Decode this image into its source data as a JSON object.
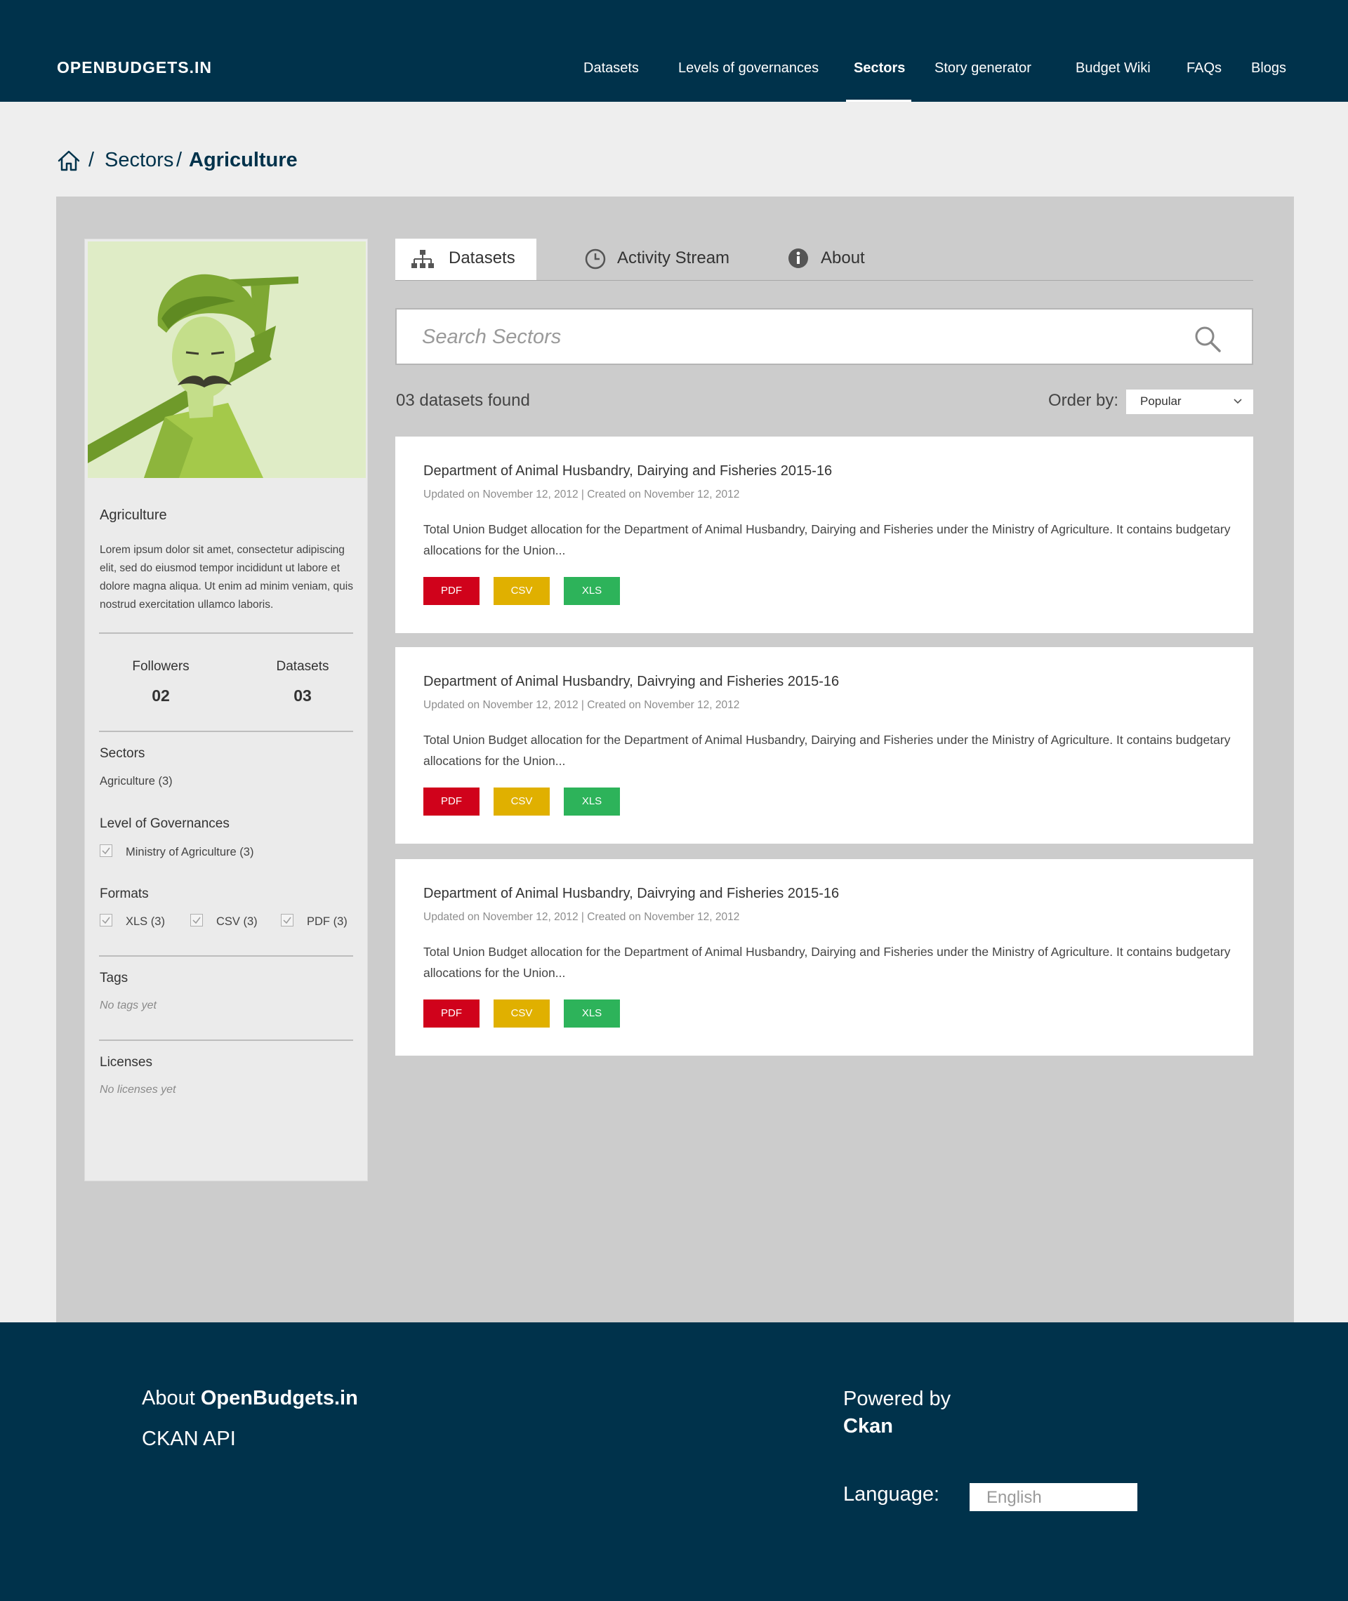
{
  "header": {
    "logo": "OPENBUDGETS.IN",
    "nav": [
      {
        "label": "Datasets",
        "active": false
      },
      {
        "label": "Levels of governances",
        "active": false
      },
      {
        "label": "Sectors",
        "active": true
      },
      {
        "label": "Story generator",
        "active": false
      },
      {
        "label": "Budget Wiki",
        "active": false
      },
      {
        "label": "FAQs",
        "active": false
      },
      {
        "label": "Blogs",
        "active": false
      }
    ]
  },
  "breadcrumb": {
    "sep": "/",
    "parent": "Sectors",
    "current": "Agriculture"
  },
  "sidebar": {
    "title": "Agriculture",
    "description": "Lorem ipsum dolor sit amet, consectetur adipiscing elit, sed do eiusmod tempor incididunt ut labore et dolore magna aliqua. Ut enim ad minim veniam, quis nostrud exercitation ullamco laboris.",
    "followers_label": "Followers",
    "followers_value": "02",
    "datasets_label": "Datasets",
    "datasets_value": "03",
    "sectors_heading": "Sectors",
    "sectors_item": "Agriculture (3)",
    "governance_heading": "Level of Governances",
    "governance_item": "Ministry of Agriculture (3)",
    "formats_heading": "Formats",
    "formats": [
      "XLS (3)",
      "CSV (3)",
      "PDF (3)"
    ],
    "tags_heading": "Tags",
    "tags_empty": "No tags yet",
    "licenses_heading": "Licenses",
    "licenses_empty": "No licenses yet"
  },
  "tabs": [
    {
      "label": "Datasets",
      "icon": "sitemap-icon",
      "active": true
    },
    {
      "label": "Activity Stream",
      "icon": "clock-icon",
      "active": false
    },
    {
      "label": "About",
      "icon": "info-icon",
      "active": false
    }
  ],
  "search": {
    "placeholder": "Search Sectors",
    "value": ""
  },
  "results": {
    "found": "03 datasets found",
    "order_label": "Order by:",
    "order_value": "Popular"
  },
  "datasets": [
    {
      "title": "Department of Animal Husbandry, Dairying and Fisheries 2015-16",
      "meta": "Updated on November 12, 2012 | Created on November 12, 2012",
      "description": "Total Union Budget allocation for the Department of Animal Husbandry, Dairying and Fisheries under the Ministry of Agriculture. It contains budgetary allocations for the Union...",
      "formats": [
        "PDF",
        "CSV",
        "XLS"
      ]
    },
    {
      "title": "Department of Animal Husbandry, Daivrying and Fisheries 2015-16",
      "meta": "Updated on November 12, 2012 | Created on November 12, 2012",
      "description": "Total Union Budget allocation for the Department of Animal Husbandry, Dairying and Fisheries under the Ministry of Agriculture. It contains budgetary allocations for the Union...",
      "formats": [
        "PDF",
        "CSV",
        "XLS"
      ]
    },
    {
      "title": "Department of Animal Husbandry, Daivrying and Fisheries 2015-16",
      "meta": "Updated on November 12, 2012 | Created on November 12, 2012",
      "description": "Total Union Budget allocation for the Department of Animal Husbandry, Dairying and Fisheries under the Ministry of Agriculture. It contains budgetary allocations for the Union...",
      "formats": [
        "PDF",
        "CSV",
        "XLS"
      ]
    }
  ],
  "format_colors": {
    "PDF": "#d0021b",
    "CSV": "#e0b000",
    "XLS": "#2db35a"
  },
  "footer": {
    "about_prefix": "About ",
    "about_brand": "OpenBudgets.in",
    "api": "CKAN API",
    "powered_by": "Powered by",
    "powered_brand": "Ckan",
    "language_label": "Language:",
    "language_value": "English"
  }
}
